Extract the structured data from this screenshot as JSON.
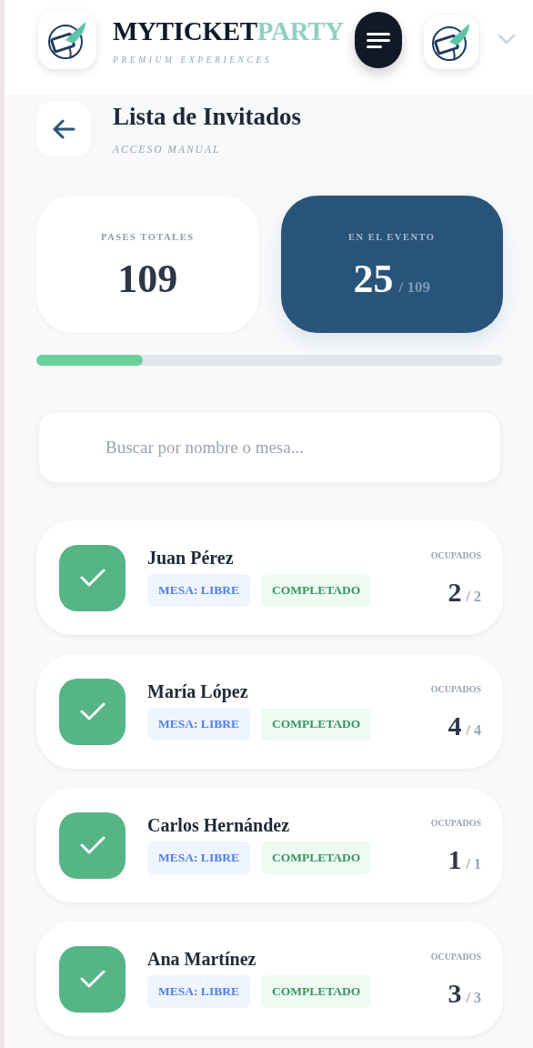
{
  "header": {
    "brand_primary": "MYTICKET",
    "brand_accent": "PARTY",
    "tagline": "PREMIUM EXPERIENCES"
  },
  "page": {
    "title": "Lista de Invitados",
    "subtitle": "ACCESO MANUAL"
  },
  "stats": [
    {
      "label": "PASES TOTALES",
      "value": "109",
      "kind": "plain"
    },
    {
      "label": "EN EL EVENTO",
      "value": "25",
      "total": "/ 109",
      "kind": "highlight"
    }
  ],
  "progress": {
    "level": 0.229
  },
  "search": {
    "placeholder": "Buscar por nombre o mesa..."
  },
  "guests": [
    {
      "name": "Juan Pérez",
      "checked_in": true,
      "table": "MESA: LIBRE",
      "status": "COMPLETADO",
      "seats_label": "OCUPADOS",
      "seats": "2",
      "total": "/ 2"
    },
    {
      "name": "María López",
      "checked_in": true,
      "table": "MESA: LIBRE",
      "status": "COMPLETADO",
      "seats_label": "OCUPADOS",
      "seats": "4",
      "total": "/ 4"
    },
    {
      "name": "Carlos Hernández",
      "checked_in": true,
      "table": "MESA: LIBRE",
      "status": "COMPLETADO",
      "seats_label": "OCUPADOS",
      "seats": "1",
      "total": "/ 1"
    },
    {
      "name": "Ana Martínez",
      "checked_in": true,
      "table": "MESA: LIBRE",
      "status": "COMPLETADO",
      "seats_label": "OCUPADOS",
      "seats": "3",
      "total": "/ 3"
    }
  ]
}
